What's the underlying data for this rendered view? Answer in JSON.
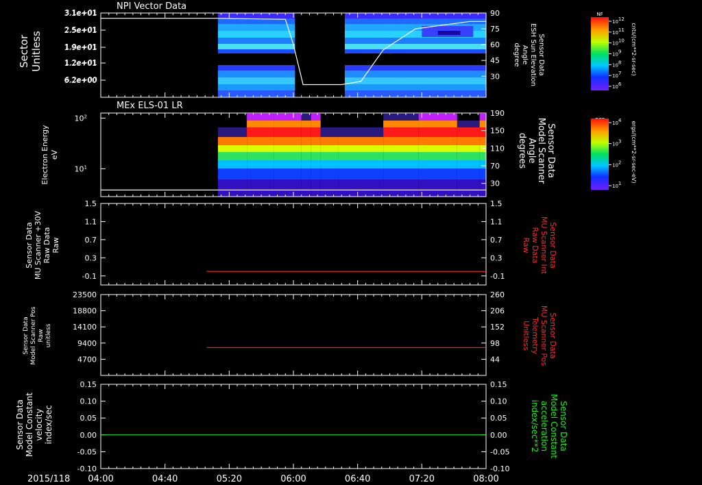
{
  "colors": {
    "background": "#000000",
    "foreground": "#ffffff",
    "red": "#ff2a2a",
    "green": "#22ee22"
  },
  "date_label": "2015/118",
  "x_ticks": [
    {
      "t": 0,
      "label": "04:00"
    },
    {
      "t": 40,
      "label": "04:40"
    },
    {
      "t": 80,
      "label": "05:20"
    },
    {
      "t": 120,
      "label": "06:00"
    },
    {
      "t": 160,
      "label": "06:40"
    },
    {
      "t": 200,
      "label": "07:20"
    },
    {
      "t": 240,
      "label": "08:00"
    }
  ],
  "chart_data": [
    {
      "type": "heatmap",
      "title": "NPI Vector Data",
      "ylabel": [
        "Sector",
        "Unitless"
      ],
      "y_ticks": [
        "3.1e+01",
        "2.5e+01",
        "1.9e+01",
        "1.2e+01",
        "6.2e+00"
      ],
      "y2label": [
        "Sensor Data",
        "ESH Sun Elevation",
        "Angle",
        "degree"
      ],
      "y2_ticks": [
        {
          "v": 90,
          "label": "90"
        },
        {
          "v": 75,
          "label": "75"
        },
        {
          "v": 60,
          "label": "60"
        },
        {
          "v": 45,
          "label": "45"
        },
        {
          "v": 30,
          "label": "30"
        }
      ],
      "y2lim": [
        10,
        90
      ],
      "data_intervals_min": [
        [
          73,
          121
        ],
        [
          152,
          240
        ]
      ],
      "overlay_line": {
        "x_min": [
          0,
          73,
          115,
          120,
          126,
          150,
          162,
          176,
          196,
          230,
          240
        ],
        "values": [
          85,
          85,
          84,
          60,
          22,
          22,
          25,
          55,
          75,
          82,
          82
        ]
      },
      "colorbar": {
        "label": "NF",
        "ticks": [
          "10^12",
          "10^11",
          "10^10",
          "10^9",
          "10^8",
          "10^7",
          "10^6"
        ],
        "units": "cnts/(cm**2-sr-sec)"
      }
    },
    {
      "type": "heatmap",
      "title": "MEx ELS-01 LR",
      "ylabel": [
        "Electron Energy",
        "eV"
      ],
      "y_ticks": [
        {
          "exp": 2,
          "label": "10^2"
        },
        {
          "exp": 1,
          "label": "10^1"
        }
      ],
      "yscale": "log",
      "y2label": [
        "Sensor Data",
        "Model Scanner",
        "Angle",
        "degrees"
      ],
      "y2_ticks": [
        {
          "v": 190,
          "label": "190"
        },
        {
          "v": 150,
          "label": "150"
        },
        {
          "v": 110,
          "label": "110"
        },
        {
          "v": 70,
          "label": "70"
        },
        {
          "v": 30,
          "label": "30"
        }
      ],
      "y2lim": [
        0,
        190
      ],
      "data_interval_min": [
        73,
        240
      ],
      "overlay_line": {
        "x_min": [
          0,
          240
        ],
        "values": [
          15,
          15
        ]
      },
      "colorbar": {
        "label": "DEF",
        "ticks": [
          "10^4",
          "10^3",
          "10^2",
          "10^1"
        ],
        "units": "ergs/(cm**2-sr-sec-eV)"
      }
    },
    {
      "type": "line",
      "ylabel": [
        "Sensor Data",
        "MU Scanner +30V",
        "Raw Data",
        "Raw"
      ],
      "y_ticks": [
        "1.5",
        "1.1",
        "0.7",
        "0.3",
        "-0.1"
      ],
      "ylim": [
        -0.3,
        1.5
      ],
      "y2label": [
        "Sensor Data",
        "MU Scanner Int",
        "Raw Data",
        "Raw"
      ],
      "y2_ticks": [
        "1.5",
        "1.1",
        "0.7",
        "0.3",
        "-0.1"
      ],
      "series": [
        {
          "x_min": [
            66,
            240
          ],
          "values": [
            0.0,
            0.0
          ],
          "color": "#ff2a2a"
        }
      ]
    },
    {
      "type": "line",
      "ylabel": [
        "Sensor Data",
        "Model Scanner Pos",
        "Raw",
        "unitless"
      ],
      "y_ticks": [
        "23500",
        "18800",
        "14100",
        "9400",
        "4700"
      ],
      "ylim": [
        0,
        23500
      ],
      "y2label": [
        "Sensor Data",
        "MU Scanner Pos",
        "Telemetry",
        "Unitless"
      ],
      "y2_ticks": [
        "260",
        "206",
        "152",
        "98",
        "44"
      ],
      "series": [
        {
          "x_min": [
            66,
            240
          ],
          "values": [
            8100,
            8100
          ],
          "color": "#ff2a2a"
        }
      ]
    },
    {
      "type": "line",
      "ylabel": [
        "Sensor Data",
        "Model Constant",
        "velocity",
        "index/sec"
      ],
      "y_ticks": [
        "0.15",
        "0.10",
        "0.05",
        "0.00",
        "-0.05",
        "-0.10"
      ],
      "ylim": [
        -0.1,
        0.15
      ],
      "y2label": [
        "Sensor Data",
        "Model Constant",
        "acceleration",
        "index/sec**2"
      ],
      "y2_ticks": [
        "0.15",
        "0.10",
        "0.05",
        "0.00",
        "-0.05",
        "-0.10"
      ],
      "series": [
        {
          "x_min": [
            0,
            240
          ],
          "values": [
            0.0,
            0.0
          ],
          "color": "#22ee22"
        }
      ]
    }
  ]
}
